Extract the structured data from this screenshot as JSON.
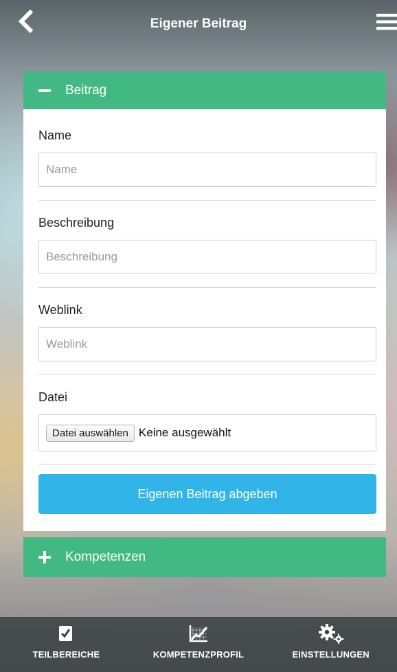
{
  "header": {
    "title": "Eigener Beitrag"
  },
  "beitrag_panel": {
    "title": "Beitrag",
    "expanded": true,
    "fields": [
      {
        "label": "Name",
        "placeholder": "Name",
        "value": ""
      },
      {
        "label": "Beschreibung",
        "placeholder": "Beschreibung",
        "value": ""
      },
      {
        "label": "Weblink",
        "placeholder": "Weblink",
        "value": ""
      }
    ],
    "file": {
      "label": "Datei",
      "button_label": "Datei auswählen",
      "status": "Keine ausgewählt"
    },
    "submit_label": "Eigenen Beitrag abgeben"
  },
  "kompetenzen_panel": {
    "title": "Kompetenzen",
    "expanded": false
  },
  "bottom_nav": {
    "items": [
      {
        "label": "TEILBEREICHE",
        "icon": "document-check-icon"
      },
      {
        "label": "KOMPETENZPROFIL",
        "icon": "chart-icon"
      },
      {
        "label": "EINSTELLUNGEN",
        "icon": "gears-icon"
      }
    ]
  },
  "colors": {
    "accent_green": "#42b883",
    "button_blue": "#31b5e8",
    "nav_bg": "#3c4244"
  }
}
